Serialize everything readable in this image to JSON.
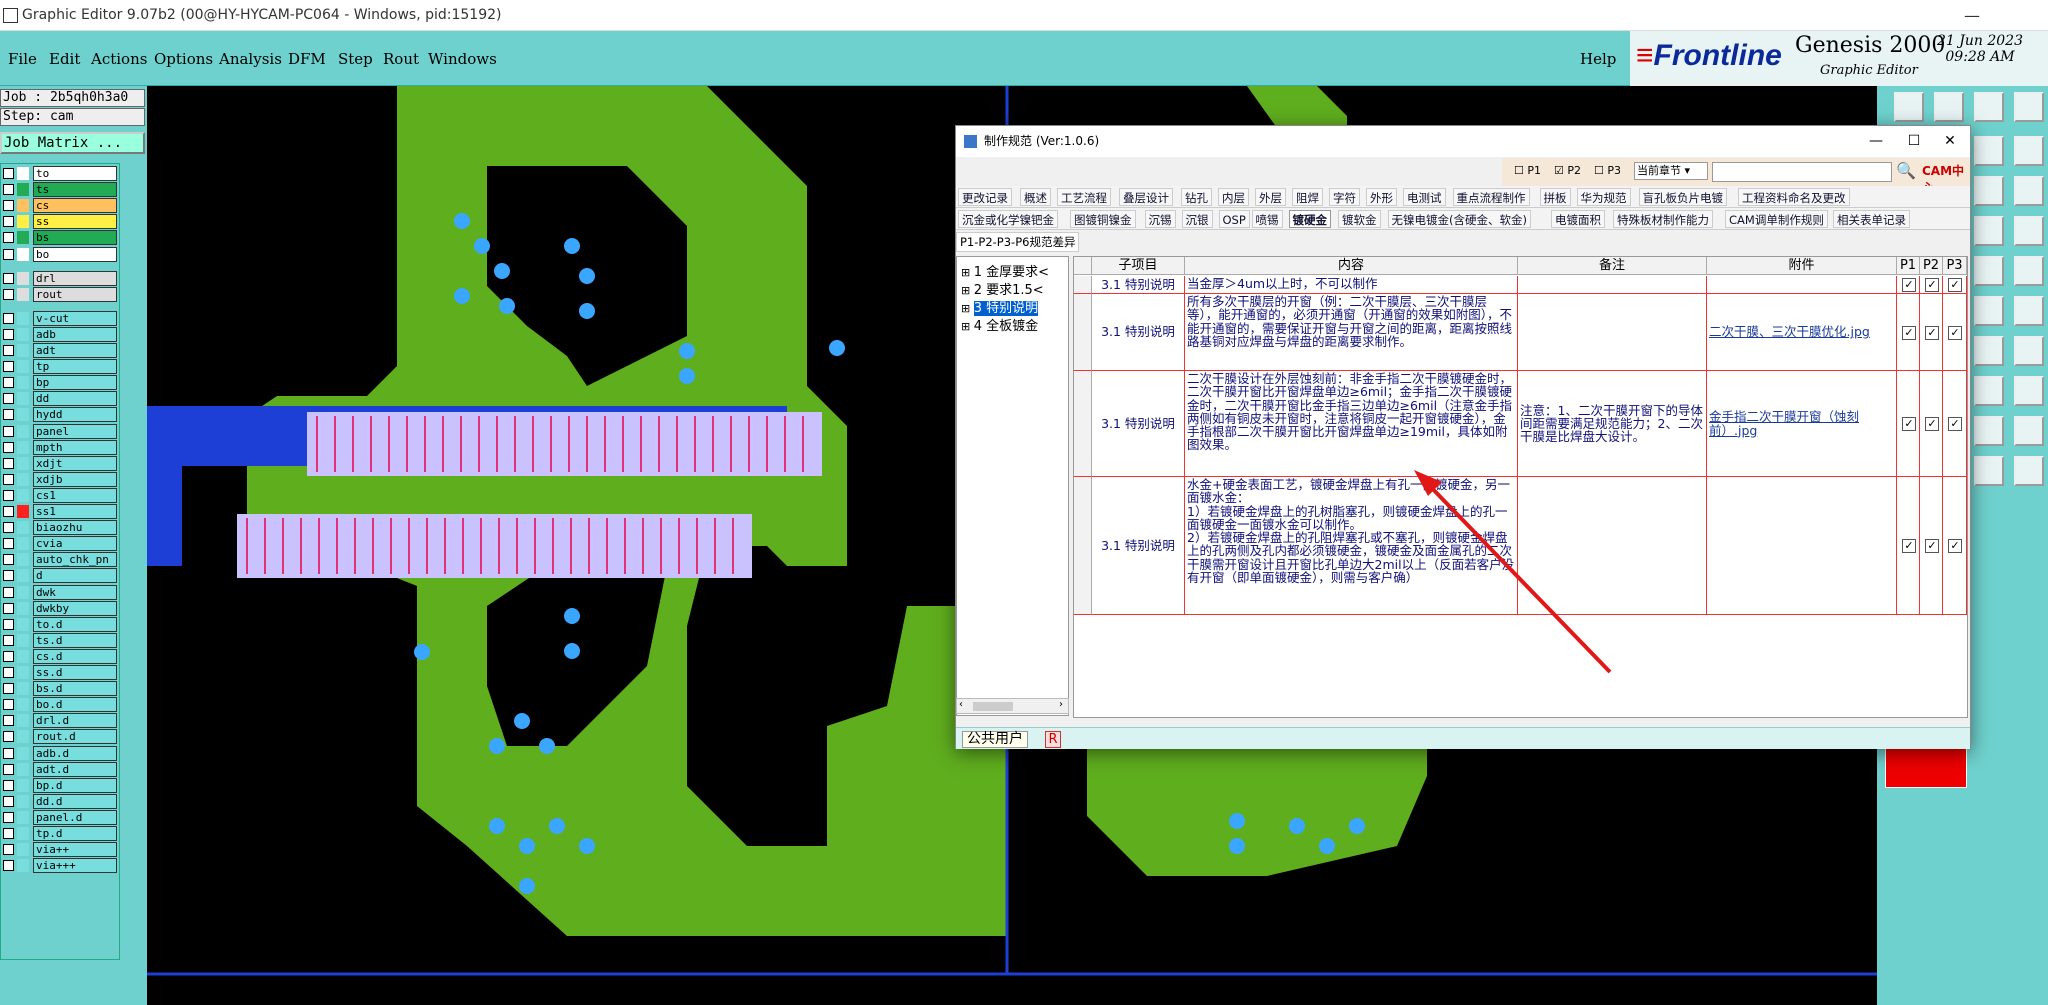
{
  "window": {
    "title": "Graphic Editor 9.07b2 (00@HY-HYCAM-PC064 - Windows, pid:15192)"
  },
  "menu": [
    "File",
    "Edit",
    "Actions",
    "Options",
    "Analysis",
    "DFM",
    "Step",
    "Rout",
    "Windows"
  ],
  "help": "Help",
  "brand": {
    "logo_a": "Frontline",
    "product": "Genesis 2000",
    "sub": "Graphic Editor",
    "date": "21 Jun 2023",
    "time": "09:28 AM"
  },
  "job": {
    "job": "Job : 2b5qh0h3a0",
    "step": "Step: cam",
    "matrix": "Job Matrix ..."
  },
  "layers": [
    {
      "name": "to",
      "sw": "#ffffff"
    },
    {
      "name": "ts",
      "sw": "#22aa55"
    },
    {
      "name": "cs",
      "sw": "#ffc060"
    },
    {
      "name": "ss",
      "sw": "#ffee44"
    },
    {
      "name": "bs",
      "sw": "#22aa55"
    },
    {
      "name": "bo",
      "sw": "#ffffff"
    },
    {
      "name": "drl",
      "sw": "#dddddd"
    },
    {
      "name": "rout",
      "sw": "#dddddd"
    },
    {
      "name": "v-cut"
    },
    {
      "name": "adb"
    },
    {
      "name": "adt"
    },
    {
      "name": "tp"
    },
    {
      "name": "bp"
    },
    {
      "name": "dd"
    },
    {
      "name": "hydd"
    },
    {
      "name": "panel"
    },
    {
      "name": "mpth"
    },
    {
      "name": "xdjt"
    },
    {
      "name": "xdjb"
    },
    {
      "name": "cs1"
    },
    {
      "name": "ss1"
    },
    {
      "name": "biaozhu"
    },
    {
      "name": "cvia"
    },
    {
      "name": "auto_chk_pn"
    },
    {
      "name": "d"
    },
    {
      "name": "dwk"
    },
    {
      "name": "dwkby"
    },
    {
      "name": "to.d"
    },
    {
      "name": "ts.d"
    },
    {
      "name": "cs.d"
    },
    {
      "name": "ss.d"
    },
    {
      "name": "bs.d"
    },
    {
      "name": "bo.d"
    },
    {
      "name": "drl.d"
    },
    {
      "name": "rout.d"
    },
    {
      "name": "adb.d"
    },
    {
      "name": "adt.d"
    },
    {
      "name": "bp.d"
    },
    {
      "name": "dd.d"
    },
    {
      "name": "panel.d"
    },
    {
      "name": "tp.d"
    },
    {
      "name": "via++"
    },
    {
      "name": "via+++"
    }
  ],
  "dialog": {
    "title": "制作规范 (Ver:1.0.6)",
    "search": {
      "p1": "P1",
      "p2": "P2",
      "p3": "P3",
      "scope": "当前章节"
    },
    "cam_logo": "CAM中心",
    "tabs_row1": [
      "更改记录",
      "概述",
      "工艺流程",
      "叠层设计",
      "钻孔",
      "内层",
      "外层",
      "阻焊",
      "字符",
      "外形",
      "电测试",
      "重点流程制作",
      "拼板",
      "华为规范",
      "盲孔板负片电镀",
      "工程资料命名及更改"
    ],
    "tabs_row2": [
      "沉金或化学镍钯金",
      "图镀铜镍金",
      "沉锡",
      "沉银",
      "OSP",
      "喷锡",
      "镀硬金",
      "镀软金",
      "无镍电镀金(含硬金、软金)",
      "电镀面积",
      "特殊板材制作能力",
      "CAM调单制作规则",
      "相关表单记录"
    ],
    "active_tab": "镀硬金",
    "subtab": "P1-P2-P3-P6规范差异",
    "tree": [
      {
        "label": "1 金厚要求<"
      },
      {
        "label": "2 要求1.5<"
      },
      {
        "label": "3 特别说明",
        "selected": true
      },
      {
        "label": "4 全板镀金"
      }
    ],
    "columns": [
      "子项目",
      "内容",
      "备注",
      "附件",
      "P1",
      "P2",
      "P3"
    ],
    "rows": [
      {
        "sub": "3.1 特别说明",
        "content": "当金厚＞4um以上时，不可以制作",
        "note": "",
        "att": ""
      },
      {
        "sub": "3.1 特别说明",
        "content": "所有多次干膜层的开窗（例：二次干膜层、三次干膜层等），能开通窗的，必须开通窗（开通窗的效果如附图），不能开通窗的，需要保证开窗与开窗之间的距离，距离按照线路基铜对应焊盘与焊盘的距离要求制作。",
        "note": "",
        "att": "二次干膜、三次干膜优化.jpg"
      },
      {
        "sub": "3.1 特别说明",
        "content": "二次干膜设计在外层蚀刻前：非金手指二次干膜镀硬金时，二次干膜开窗比开窗焊盘单边≥6mil；金手指二次干膜镀硬金时，二次干膜开窗比金手指三边单边≥6mil（注意金手指两侧如有铜皮未开窗时，注意将铜皮一起开窗镀硬金），金手指根部二次干膜开窗比开窗焊盘单边≥19mil，具体如附图效果。",
        "note": "注意：1、二次干膜开窗下的导体间距需要满足规范能力；2、二次干膜是比焊盘大设计。",
        "att": "金手指二次干膜开窗（蚀刻前）.jpg"
      },
      {
        "sub": "3.1 特别说明",
        "content": "水金+硬金表面工艺，镀硬金焊盘上有孔一面镀硬金，另一面镀水金：\n1）若镀硬金焊盘上的孔树脂塞孔，则镀硬金焊盘上的孔一面镀硬金一面镀水金可以制作。\n2）若镀硬金焊盘上的孔阻焊塞孔或不塞孔，则镀硬金焊盘上的孔两侧及孔内都必须镀硬金，镀硬金及面金属孔的二次干膜需开窗设计且开窗比孔单边大2mil以上（反面若客户没有开窗（即单面镀硬金），则需与客户确）",
        "note": "",
        "att": ""
      }
    ],
    "status_user": "公共用户",
    "status_r": "R"
  }
}
